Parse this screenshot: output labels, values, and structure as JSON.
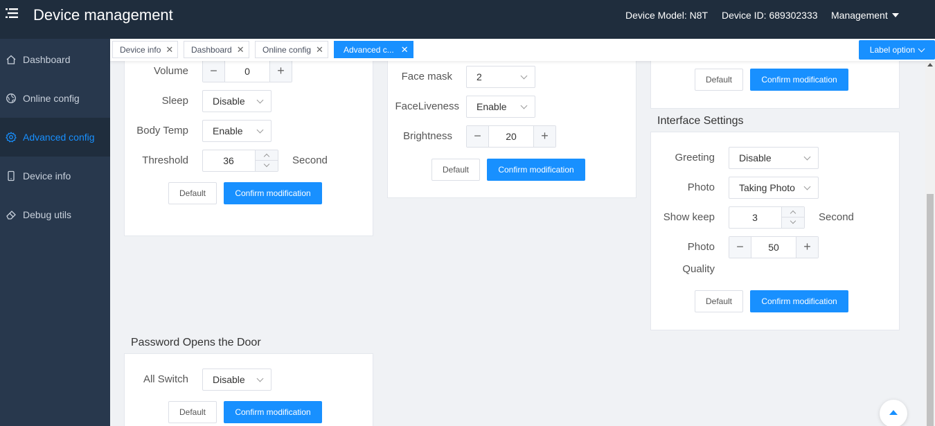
{
  "header": {
    "title": "Device management",
    "device_model": "Device Model: N8T",
    "device_id": "Device ID: 689302333",
    "management": "Management"
  },
  "sidebar": {
    "items": [
      {
        "label": "Dashboard",
        "icon": "home-icon"
      },
      {
        "label": "Online config",
        "icon": "globe-icon"
      },
      {
        "label": "Advanced config",
        "icon": "gear-icon",
        "active": true
      },
      {
        "label": "Device info",
        "icon": "phone-icon"
      },
      {
        "label": "Debug utils",
        "icon": "eraser-icon"
      }
    ]
  },
  "tabs": [
    {
      "label": "Device info"
    },
    {
      "label": "Dashboard"
    },
    {
      "label": "Online config"
    },
    {
      "label": "Advanced c...",
      "active": true
    }
  ],
  "label_option": "Label option",
  "col1": {
    "volume_label": "Volume",
    "volume_value": "0",
    "sleep_label": "Sleep",
    "sleep_value": "Disable",
    "bodytemp_label": "Body Temp",
    "bodytemp_value": "Enable",
    "threshold_label": "Threshold",
    "threshold_value": "36",
    "threshold_suffix": "Second",
    "default_btn": "Default",
    "confirm_btn": "Confirm modification"
  },
  "password_section": {
    "title": "Password Opens the Door",
    "switch_label": "All Switch",
    "switch_value": "Disable",
    "default_btn": "Default",
    "confirm_btn": "Confirm modification"
  },
  "col2": {
    "facemask_label": "Face mask",
    "facemask_value": "2",
    "faceliveness_label": "FaceLiveness",
    "faceliveness_value": "Enable",
    "brightness_label": "Brightness",
    "brightness_value": "20",
    "default_btn": "Default",
    "confirm_btn": "Confirm modification"
  },
  "col3_top": {
    "default_btn": "Default",
    "confirm_btn": "Confirm modification"
  },
  "interface_section": {
    "title": "Interface Settings",
    "greeting_label": "Greeting",
    "greeting_value": "Disable",
    "photo_label": "Photo",
    "photo_value": "Taking Photo",
    "showkeep_label": "Show keep",
    "showkeep_value": "3",
    "showkeep_suffix": "Second",
    "quality_label_1": "Photo",
    "quality_label_2": "Quality",
    "quality_value": "50",
    "default_btn": "Default",
    "confirm_btn": "Confirm modification"
  },
  "colors": {
    "header_bg": "#1f2d3d",
    "sidebar_bg": "#28384d",
    "accent": "#1890ff"
  }
}
